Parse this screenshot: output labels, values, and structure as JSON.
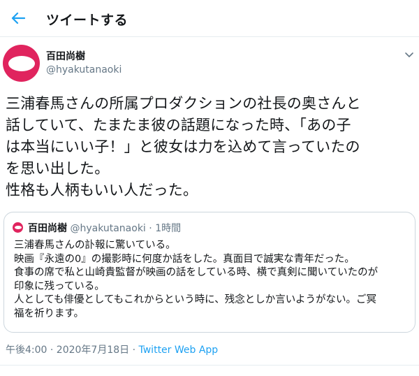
{
  "header": {
    "title": "ツイートする",
    "back_icon": "arrow-left-icon"
  },
  "colors": {
    "accent": "#1da1f2",
    "avatar": "#e0245e",
    "secondary_text": "#657786"
  },
  "tweet": {
    "author_name": "百田尚樹",
    "author_handle": "@hyakutanaoki",
    "text_lines": [
      "三浦春馬さんの所属プロダクションの社長の奥さんと",
      "話していて、たまたま彼の話題になった時、「あの子",
      "は本当にいい子！」と彼女は力を込めて言っていたの",
      "を思い出した。",
      "性格も人柄もいい人だった。"
    ]
  },
  "quoted": {
    "author_name": "百田尚樹",
    "author_handle": "@hyakutanaoki",
    "separator": "·",
    "time": "1時間",
    "text_lines": [
      "三浦春馬さんの訃報に驚いている。",
      "映画『永遠の0』の撮影時に何度か話をした。真面目で誠実な青年だった。",
      "食事の席で私と山崎貴監督が映画の話をしている時、横で真剣に聞いていたのが",
      "印象に残っている。",
      "人としても俳優としてもこれからという時に、残念としか言いようがない。ご冥",
      "福を祈ります。"
    ]
  },
  "footer": {
    "timestamp": "午後4:00 · 2020年7月18日 · ",
    "source": "Twitter Web App"
  }
}
